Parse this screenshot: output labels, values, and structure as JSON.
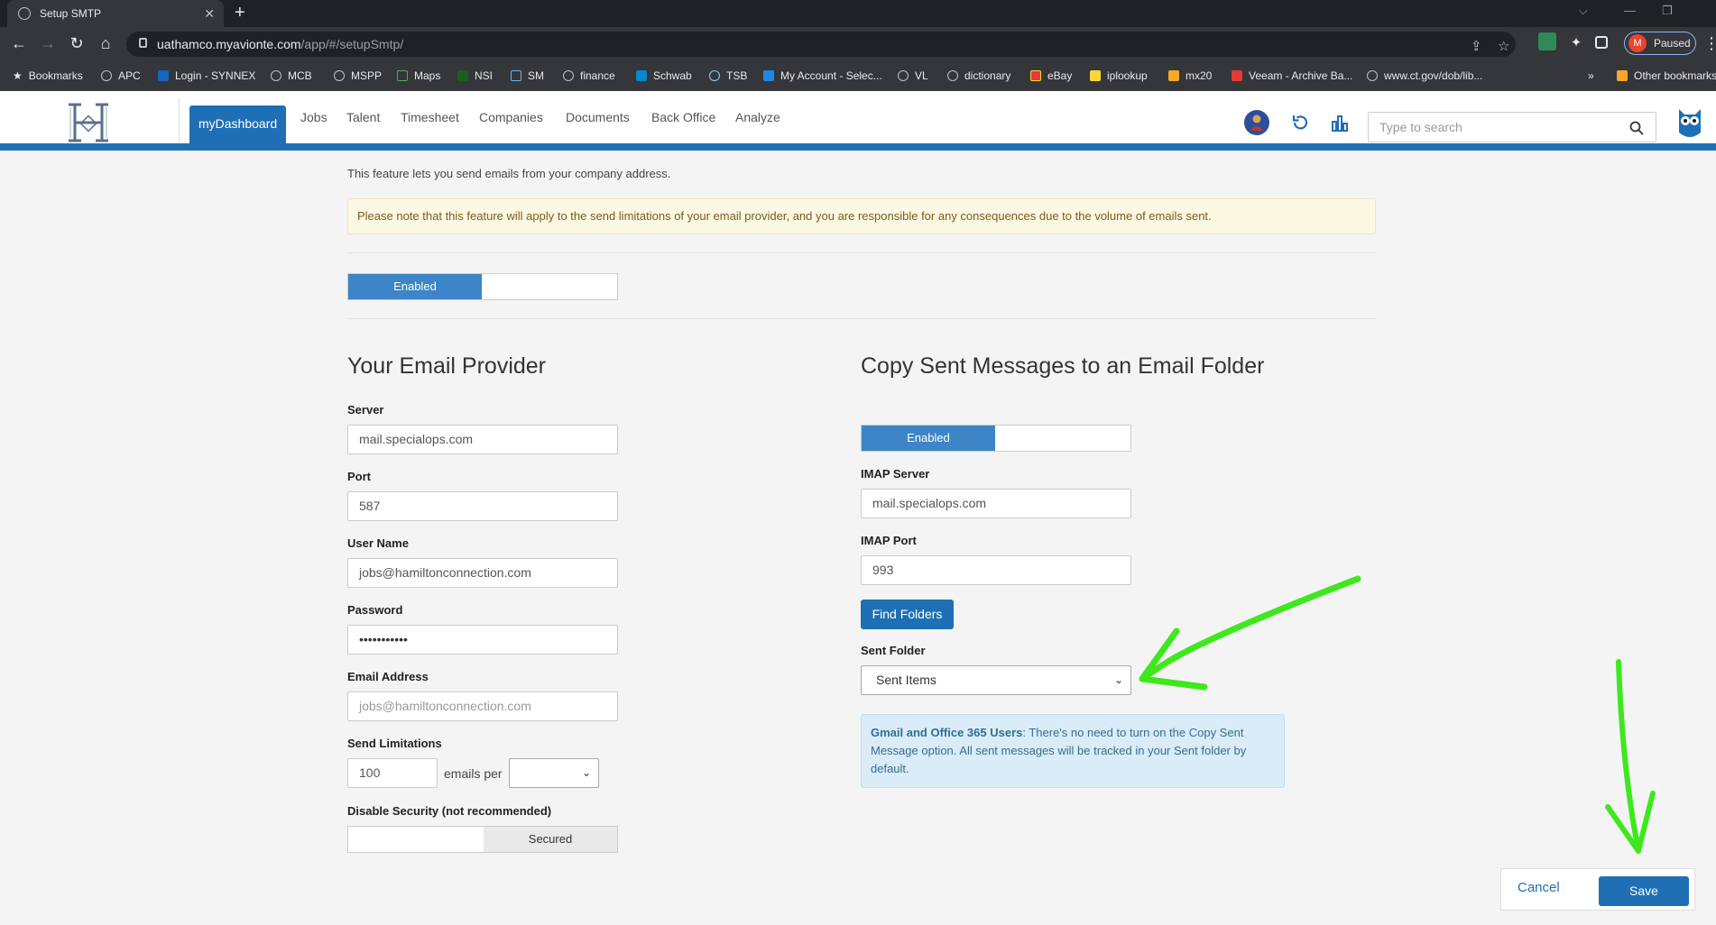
{
  "browser": {
    "tab_title": "Setup SMTP",
    "url_domain": "uathamco.myavionte.com",
    "url_path": "/app/#/setupSmtp/",
    "profile_status": "Paused",
    "profile_initial": "M",
    "bookmarks": [
      "Bookmarks",
      "APC",
      "Login - SYNNEX",
      "MCB",
      "MSPP",
      "Maps",
      "NSI",
      "SM",
      "finance",
      "Schwab",
      "TSB",
      "My Account - Selec...",
      "VL",
      "dictionary",
      "eBay",
      "iplookup",
      "mx20",
      "Veeam - Archive Ba...",
      "www.ct.gov/dob/lib...",
      "Other bookmarks"
    ]
  },
  "nav": {
    "items": [
      "myDashboard",
      "Jobs",
      "Talent",
      "Timesheet",
      "Companies",
      "Documents",
      "Back Office",
      "Analyze"
    ],
    "search_placeholder": "Type to search"
  },
  "page": {
    "intro": "This feature lets you send emails from your company address.",
    "notice": "Please note that this feature will apply to the send limitations of your email provider, and you are responsible for any consequences due to the volume of emails sent.",
    "smtp_toggle": "Enabled"
  },
  "provider": {
    "heading": "Your Email Provider",
    "server_label": "Server",
    "server_value": "mail.specialops.com",
    "port_label": "Port",
    "port_value": "587",
    "username_label": "User Name",
    "username_value": "jobs@hamiltonconnection.com",
    "password_label": "Password",
    "password_value": "•••••••••••",
    "email_label": "Email Address",
    "email_placeholder": "jobs@hamiltonconnection.com",
    "limit_label": "Send Limitations",
    "limit_value": "100",
    "limit_suffix": "emails per",
    "security_label": "Disable Security (not recommended)",
    "security_toggle": "Secured"
  },
  "copy": {
    "heading": "Copy Sent Messages to an Email Folder",
    "toggle": "Enabled",
    "imap_server_label": "IMAP Server",
    "imap_server_value": "mail.specialops.com",
    "imap_port_label": "IMAP Port",
    "imap_port_value": "993",
    "find_button": "Find Folders",
    "sent_label": "Sent Folder",
    "sent_value": "Sent Items",
    "info_bold": "Gmail and Office 365 Users",
    "info_text": ": There's no need to turn on the Copy Sent Message option. All sent messages will be tracked in your Sent folder by default."
  },
  "footer": {
    "cancel": "Cancel",
    "save": "Save"
  },
  "colors": {
    "brand_blue": "#1f6fb5",
    "toggle_blue": "#3d85c6",
    "annotation_green": "#3ee81d"
  }
}
